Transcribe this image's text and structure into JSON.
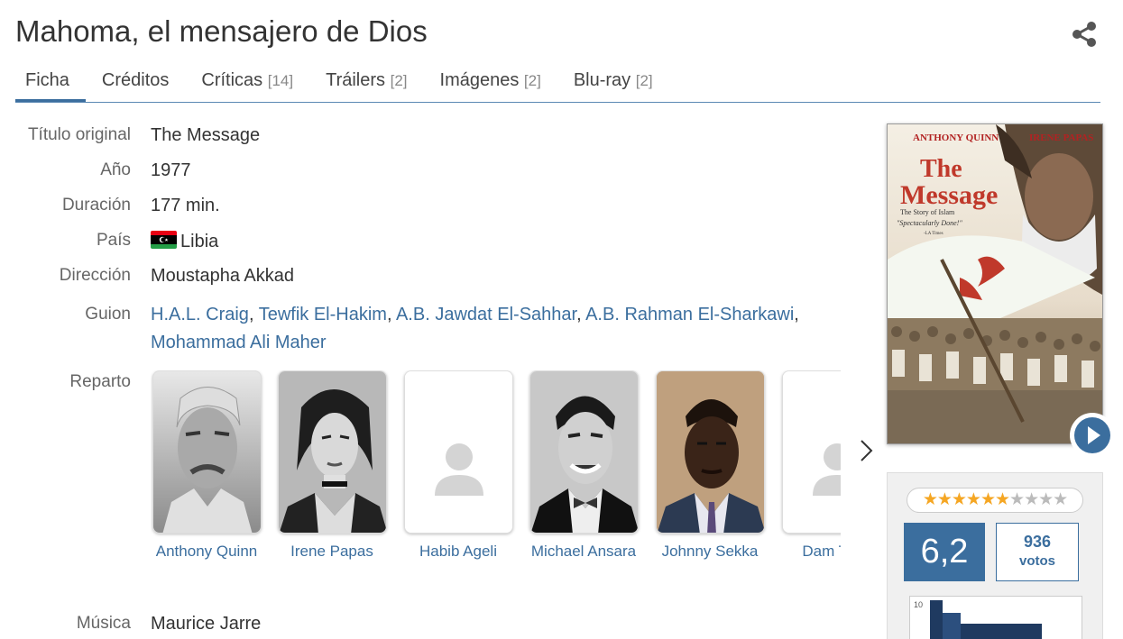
{
  "page": {
    "title": "Mahoma, el mensajero de Dios"
  },
  "icons": {
    "share": "share-icon",
    "play": "play-icon",
    "next": "chevron-right-icon",
    "placeholder": "person-placeholder-icon"
  },
  "colors": {
    "accent": "#3b6e9e",
    "star": "#f5a623"
  },
  "tabs": [
    {
      "label": "Ficha",
      "count": ""
    },
    {
      "label": "Créditos",
      "count": ""
    },
    {
      "label": "Críticas",
      "count": "[14]"
    },
    {
      "label": "Tráilers",
      "count": "[2]"
    },
    {
      "label": "Imágenes",
      "count": "[2]"
    },
    {
      "label": "Blu-ray",
      "count": "[2]"
    }
  ],
  "details": {
    "original_title_label": "Título original",
    "original_title": "The Message",
    "year_label": "Año",
    "year": "1977",
    "duration_label": "Duración",
    "duration": "177 min.",
    "country_label": "País",
    "country": "Libia",
    "direction_label": "Dirección",
    "director": "Moustapha Akkad",
    "script_label": "Guion",
    "writers": [
      "H.A.L. Craig",
      "Tewfik El-Hakim",
      "A.B. Jawdat El-Sahhar",
      "A.B. Rahman El-Sharkawi",
      "Mohammad Ali Maher"
    ],
    "cast_label": "Reparto",
    "music_label": "Música",
    "composer": "Maurice Jarre"
  },
  "cast": [
    {
      "name": "Anthony Quinn"
    },
    {
      "name": "Irene Papas"
    },
    {
      "name": "Habib Ageli"
    },
    {
      "name": "Michael Ansara"
    },
    {
      "name": "Johnny Sekka"
    },
    {
      "name": "Dam Thor"
    }
  ],
  "poster": {
    "actor_left": "ANTHONY QUINN",
    "actor_right": "IRENE PAPAS",
    "title_line1": "The",
    "title_line2": "Message",
    "subtitle": "The Story of Islam",
    "quote": "\"Spectacularly Done!\"",
    "quote_source": "-LA Times"
  },
  "rating": {
    "stars_filled": 6,
    "stars_total": 10,
    "score": "6,2",
    "votes_count": "936",
    "votes_label": "votos",
    "hist_axis_top": "10"
  }
}
